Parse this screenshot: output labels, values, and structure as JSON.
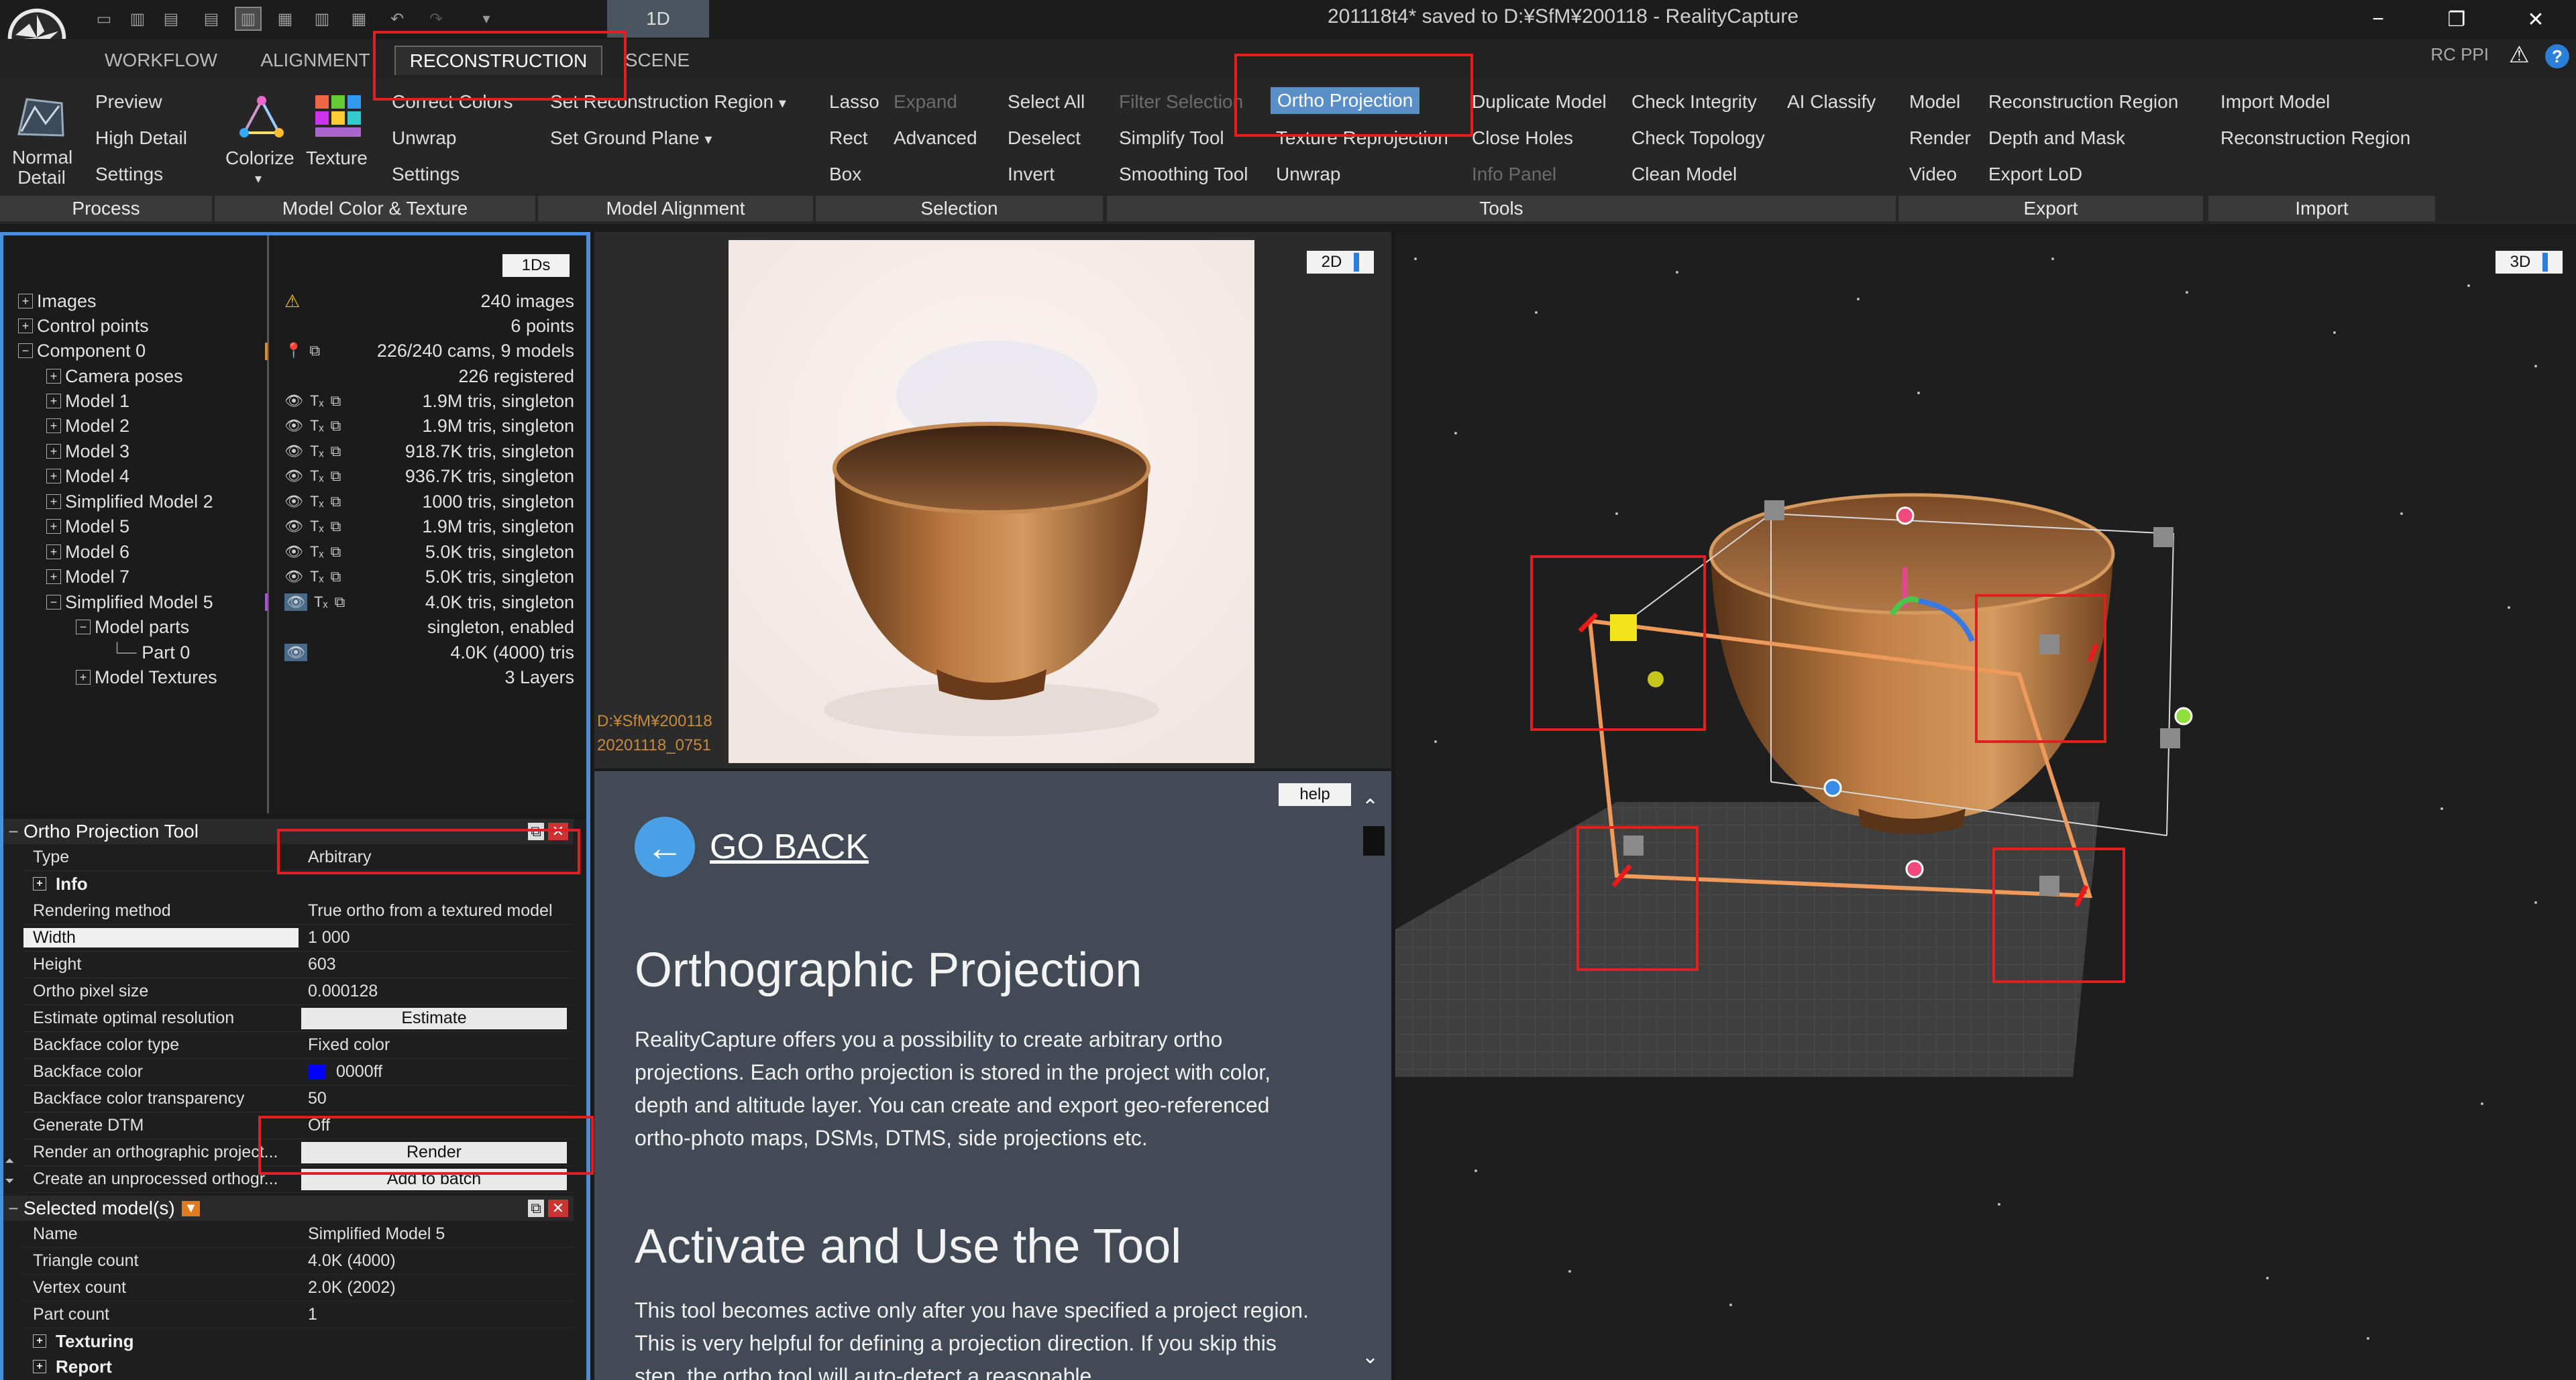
{
  "window": {
    "title": "201118t4* saved to D:¥SfM¥200118 - RealityCapture",
    "layout_label": "1D",
    "minimize": "−",
    "restore": "❐",
    "close": "✕"
  },
  "menubar": {
    "tabs": [
      "WORKFLOW",
      "ALIGNMENT",
      "RECONSTRUCTION",
      "SCENE"
    ],
    "rc_ppi": "RC PPI",
    "help_glyph": "?"
  },
  "ribbon": {
    "process": {
      "label": "Process",
      "normal_detail_line1": "Normal",
      "normal_detail_line2": "Detail",
      "items": [
        "Preview",
        "High Detail",
        "Settings"
      ]
    },
    "color_texture": {
      "label": "Model Color & Texture",
      "colorize": "Colorize",
      "texture": "Texture",
      "items": [
        "Correct Colors",
        "Unwrap",
        "Settings"
      ]
    },
    "alignment": {
      "label": "Model Alignment",
      "items": [
        "Set Reconstruction Region",
        "Set Ground Plane"
      ]
    },
    "selection": {
      "label": "Selection",
      "col1": [
        "Lasso",
        "Rect",
        "Box"
      ],
      "col2": [
        "Expand",
        "Advanced"
      ],
      "col3": [
        "Select All",
        "Deselect",
        "Invert"
      ]
    },
    "tools": {
      "label": "Tools",
      "col1": [
        "Filter Selection",
        "Simplify Tool",
        "Smoothing Tool"
      ],
      "col2": [
        "Ortho Projection",
        "Texture Reprojection",
        "Unwrap"
      ],
      "col3": [
        "Duplicate Model",
        "Close Holes",
        "Info Panel"
      ],
      "col4": [
        "Check Integrity",
        "Check Topology",
        "Clean Model"
      ],
      "col5": [
        "AI Classify"
      ]
    },
    "export": {
      "label": "Export",
      "col1": [
        "Model",
        "Render",
        "Video"
      ],
      "col2": [
        "Reconstruction Region",
        "Depth and Mask",
        "Export LoD"
      ]
    },
    "import": {
      "label": "Import",
      "items": [
        "Import Model",
        "Reconstruction Region"
      ]
    }
  },
  "tree": {
    "badge": "1Ds",
    "rows": [
      {
        "label": "Images",
        "value": "240 images"
      },
      {
        "label": "Control points",
        "value": "6 points"
      },
      {
        "label": "Component 0",
        "value": "226/240 cams, 9 models"
      },
      {
        "label": "Camera poses",
        "value": "226 registered"
      },
      {
        "label": "Model 1",
        "value": "1.9M tris, singleton"
      },
      {
        "label": "Model 2",
        "value": "1.9M tris, singleton"
      },
      {
        "label": "Model 3",
        "value": "918.7K tris, singleton"
      },
      {
        "label": "Model 4",
        "value": "936.7K tris, singleton"
      },
      {
        "label": "Simplified Model 2",
        "value": "1000 tris, singleton"
      },
      {
        "label": "Model 5",
        "value": "1.9M tris, singleton"
      },
      {
        "label": "Model 6",
        "value": "5.0K tris, singleton"
      },
      {
        "label": "Model 7",
        "value": "5.0K tris, singleton"
      },
      {
        "label": "Simplified Model 5",
        "value": "4.0K tris, singleton"
      },
      {
        "label": "Model parts",
        "value": "singleton, enabled"
      },
      {
        "label": "Part 0",
        "value": "4.0K (4000) tris"
      },
      {
        "label": "Model Textures",
        "value": "3 Layers"
      }
    ]
  },
  "ortho_tool": {
    "title": "Ortho Projection Tool",
    "info": "Info",
    "props": [
      {
        "k": "Type",
        "v": "Arbitrary"
      },
      {
        "k": "Rendering method",
        "v": "True ortho from a textured model"
      },
      {
        "k": "Width",
        "v": "1 000"
      },
      {
        "k": "Height",
        "v": "603"
      },
      {
        "k": "Ortho pixel size",
        "v": "0.000128"
      },
      {
        "k": "Estimate optimal resolution",
        "v": "Estimate"
      },
      {
        "k": "Backface color type",
        "v": "Fixed color"
      },
      {
        "k": "Backface color",
        "v": "0000ff"
      },
      {
        "k": "Backface color transparency",
        "v": "50"
      },
      {
        "k": "Generate DTM",
        "v": "Off"
      },
      {
        "k": "Render an orthographic project...",
        "v": "Render"
      },
      {
        "k": "Create an unprocessed orthogr...",
        "v": "Add to batch"
      }
    ]
  },
  "selected_models": {
    "title": "Selected model(s)",
    "props": [
      {
        "k": "Name",
        "v": "Simplified Model 5"
      },
      {
        "k": "Triangle count",
        "v": "4.0K (4000)"
      },
      {
        "k": "Vertex count",
        "v": "2.0K (2002)"
      },
      {
        "k": "Part count",
        "v": "1"
      }
    ],
    "texturing": "Texturing",
    "report": "Report"
  },
  "image_view": {
    "badge": "2D",
    "path_line1": "D:¥SfM¥200118",
    "path_line2": "20201118_0751"
  },
  "help": {
    "help_btn": "help",
    "go_back": "GO BACK",
    "h1": "Orthographic Projection",
    "p1": "RealityCapture offers you a possibility to create arbitrary ortho projections. Each ortho projection is stored in the project with color, depth and altitude layer. You can create and export geo-referenced ortho-photo maps, DSMs, DTMS, side projections etc.",
    "h2": "Activate and Use the Tool",
    "p2": "This tool becomes active only after you have specified a project region. This is very helpful for defining a projection direction. If you skip this step, the ortho tool will auto-detect a reasonable"
  },
  "view3d": {
    "badge": "3D"
  },
  "colors": {
    "accent_blue": "#4c8fd8",
    "highlight": "#5a8fc8",
    "annotation_red": "#e02020",
    "backface_color": "#0000ff"
  }
}
